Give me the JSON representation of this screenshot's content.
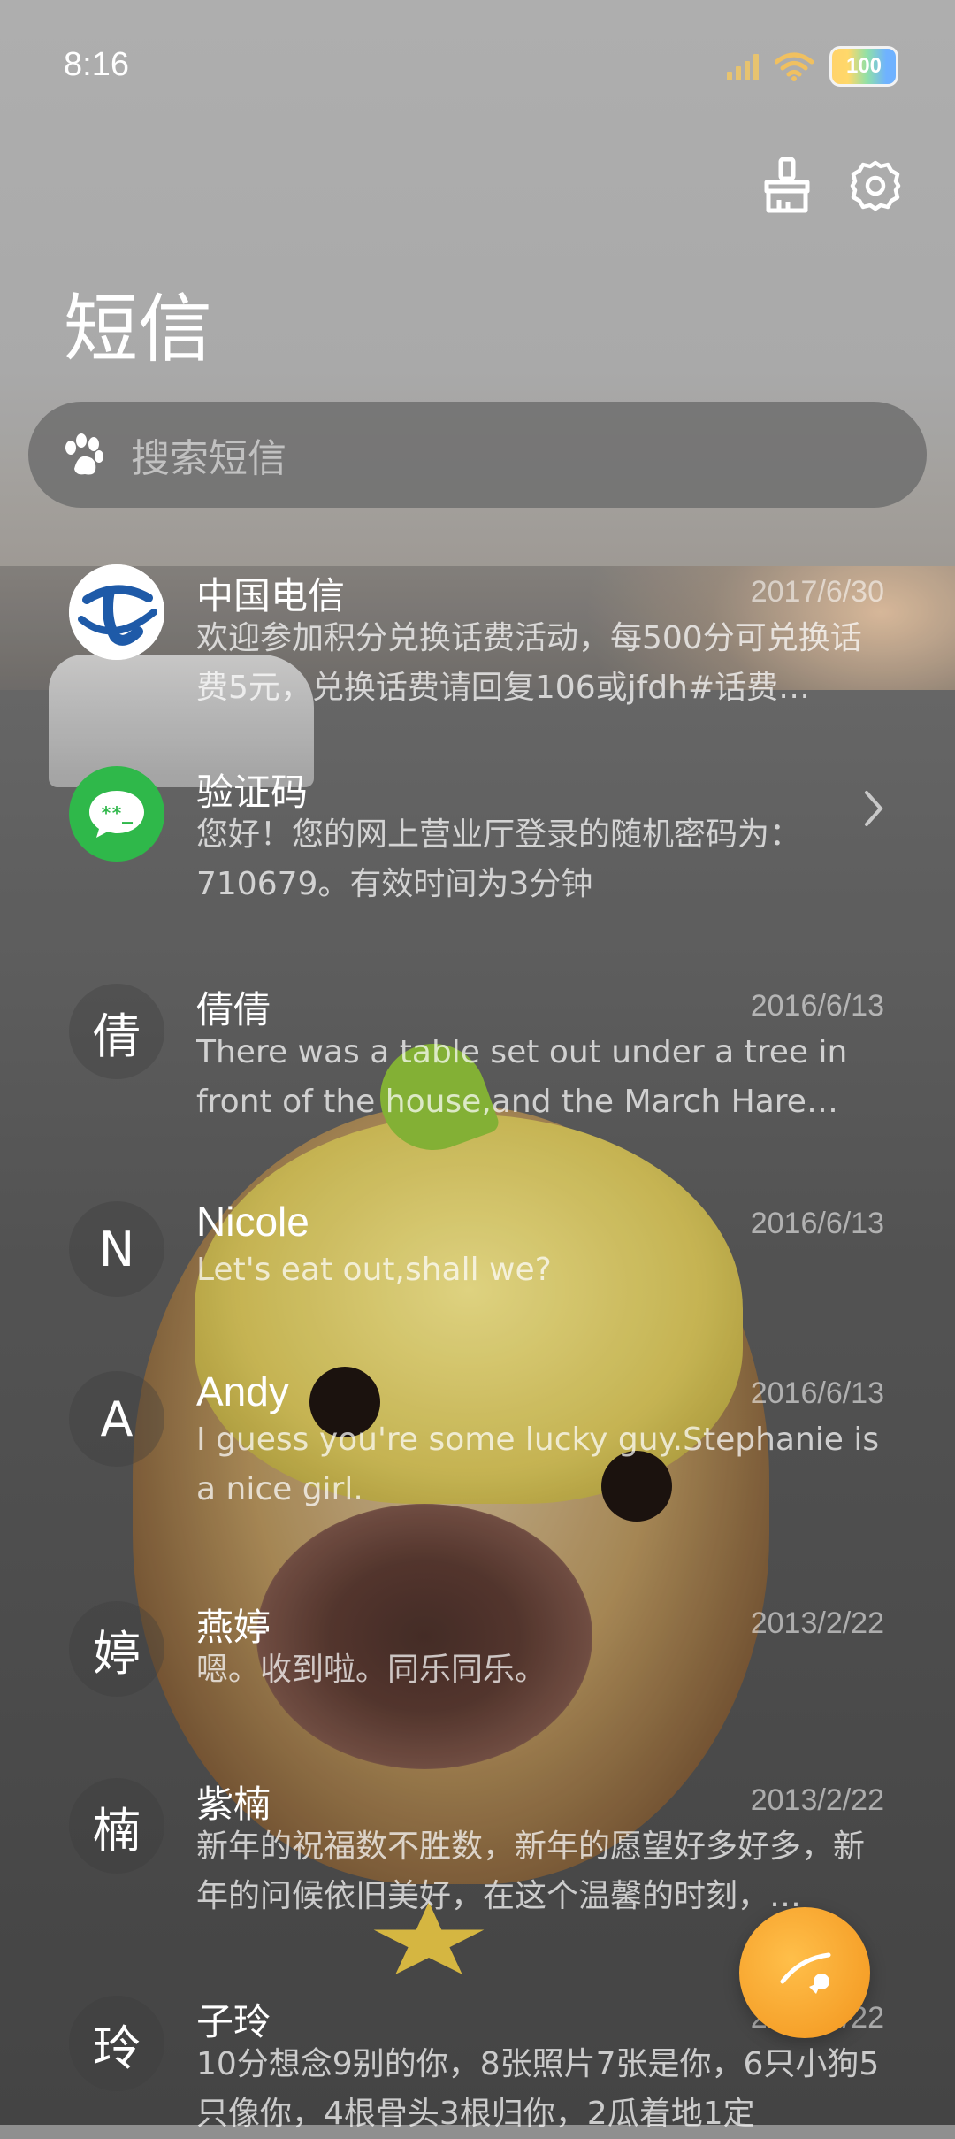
{
  "status_bar": {
    "time": "8:16",
    "battery": "100"
  },
  "header": {
    "title": "短信"
  },
  "search": {
    "placeholder": "搜索短信"
  },
  "conversations": [
    {
      "avatar": "",
      "avatar_kind": "telecom-logo",
      "name": "中国电信",
      "date": "2017/6/30",
      "preview": "欢迎参加积分兑换话费活动，每500分可兑换话费5元，兑换话费请回复106或jfdh#话费…"
    },
    {
      "avatar": "",
      "avatar_kind": "verification-icon",
      "name": "验证码",
      "date": "",
      "preview": "您好！您的网上营业厅登录的随机密码为：710679。有效时间为3分钟"
    },
    {
      "avatar": "倩",
      "name": "倩倩",
      "date": "2016/6/13",
      "preview": "There was a table set out under a tree in front of the house,and the March Hare an…"
    },
    {
      "avatar": "N",
      "name": "Nicole",
      "date": "2016/6/13",
      "preview": "Let's eat out,shall we?"
    },
    {
      "avatar": "A",
      "name": "Andy",
      "date": "2016/6/13",
      "preview": "I guess you're some lucky guy.Stephanie is a nice girl."
    },
    {
      "avatar": "婷",
      "name": "燕婷",
      "date": "2013/2/22",
      "preview": "嗯。收到啦。同乐同乐。"
    },
    {
      "avatar": "楠",
      "name": "紫楠",
      "date": "2013/2/22",
      "preview": "新年的祝福数不胜数，新年的愿望好多好多，新年的问候依旧美好，在这个温馨的时刻，…"
    },
    {
      "avatar": "玲",
      "name": "子玲",
      "date": "2013/2/22",
      "preview": "10分想念9别的你，8张照片7张是你，6只小狗5只像你，4根骨头3根归你，2瓜着地1定"
    }
  ],
  "colors": {
    "telecom_blue": "#1e5aa8",
    "verify_green": "#2fb84a",
    "fab_orange": "#f6a12a"
  },
  "icons": {
    "clean": "broom-icon",
    "settings": "gear-icon",
    "search": "paw-icon",
    "fab": "compose-icon",
    "row_arrow": "chevron-right-icon"
  }
}
